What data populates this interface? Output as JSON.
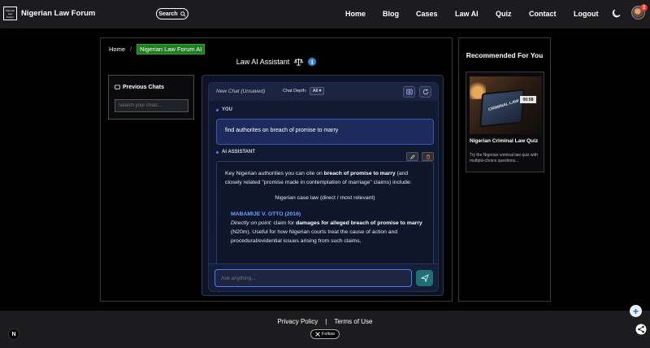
{
  "nav": {
    "logo_text": "Nigerian Law Forum",
    "brand": "Nigerian Law Forum",
    "search_label": "Search",
    "links": [
      "Home",
      "Blog",
      "Cases",
      "Law AI",
      "Quiz",
      "Contact",
      "Logout"
    ],
    "notification_count": "2"
  },
  "breadcrumb": {
    "home": "Home",
    "separator": "/",
    "current": "Nigerian Law Forum AI"
  },
  "page_title": "Law AI Assistant",
  "previous_chats": {
    "title": "Previous Chats",
    "search_placeholder": "Search your chats..."
  },
  "chat": {
    "title": "New Chat (Unsaved)",
    "depth_label": "Chat Depth:",
    "depth_value": "All",
    "user_label": "YOU",
    "user_message": "find authorites on breach of promise to marry",
    "ai_label": "AI ASSISTANT",
    "ai_intro_1": "Key Nigerian authorities you can cite on ",
    "ai_intro_bold_1": "breach of promise to marry",
    "ai_intro_2": " (and closely related \"promise made in contemplation of marriage\" claims) include:",
    "ai_section": "Nigerian case law (direct / most relevant)",
    "case_title": "MABAMIJE V. OTTO (2016)",
    "case_lead": "Directly on point:",
    "case_text_1": " claim for ",
    "case_bold_1": "damages for alleged breach of promise to marry",
    "case_text_2": " (N20m). Useful for how Nigerian courts treat the cause of action and procedural/evidential issues arising from such claims.",
    "input_placeholder": "Ask anything..."
  },
  "recommended": {
    "title": "Recommended For You",
    "image_text": "CRIMINAL LAW",
    "image_clock": "00:58",
    "card_title": "Nigerian Criminal Law Quiz",
    "card_desc": "Try the Nigerian criminal law quiz with multiple-choice questions..."
  },
  "footer": {
    "privacy": "Privacy Policy",
    "sep": "|",
    "terms": "Terms of Use",
    "follow": "Follow",
    "n_badge": "N"
  },
  "colors": {
    "accent": "#4d7bff",
    "breadcrumb_bg": "#1e7d1e",
    "case_title": "#6fa3ff",
    "notif": "#e53935"
  }
}
